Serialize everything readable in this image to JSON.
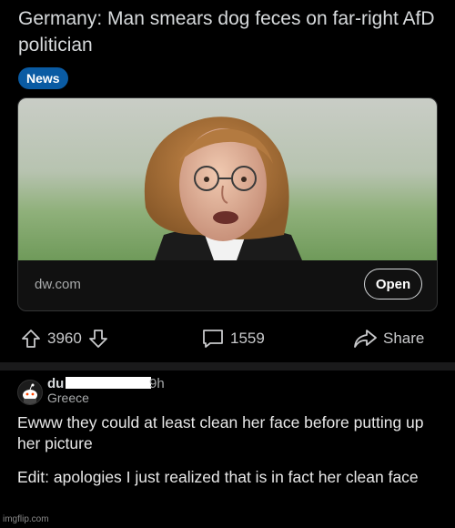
{
  "post": {
    "title": "Germany: Man smears dog feces on far-right AfD politician",
    "flair": "News"
  },
  "link_card": {
    "domain": "dw.com",
    "open_label": "Open"
  },
  "actions": {
    "upvotes": "3960",
    "comments": "1559",
    "share_label": "Share"
  },
  "comment": {
    "username_visible": "du",
    "age_visible": "9h",
    "user_flair": "Greece",
    "paragraphs": [
      "Ewww they could at least clean her face before putting up her picture",
      "Edit: apologies I just realized that is in fact her clean face"
    ]
  },
  "watermark": "imgflip.com",
  "icons": {
    "upvote": "upvote-arrow-icon",
    "downvote": "downvote-arrow-icon",
    "comments": "comment-bubble-icon",
    "share": "share-arrow-icon",
    "avatar": "reddit-snoo-avatar-icon"
  }
}
